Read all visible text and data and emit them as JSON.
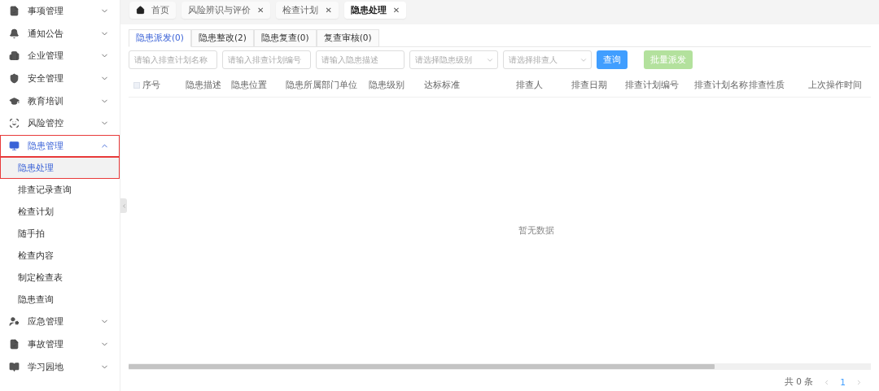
{
  "sidebar": {
    "items": [
      {
        "label": "事项管理",
        "expanded": false,
        "selected": false
      },
      {
        "label": "通知公告",
        "expanded": false,
        "selected": false
      },
      {
        "label": "企业管理",
        "expanded": false,
        "selected": false
      },
      {
        "label": "安全管理",
        "expanded": false,
        "selected": false
      },
      {
        "label": "教育培训",
        "expanded": false,
        "selected": false
      },
      {
        "label": "风险管控",
        "expanded": false,
        "selected": false
      },
      {
        "label": "隐患管理",
        "expanded": true,
        "selected": true,
        "children": [
          {
            "label": "隐患处理",
            "selected": true
          },
          {
            "label": "排查记录查询",
            "selected": false
          },
          {
            "label": "检查计划",
            "selected": false
          },
          {
            "label": "随手拍",
            "selected": false
          },
          {
            "label": "检查内容",
            "selected": false
          },
          {
            "label": "制定检查表",
            "selected": false
          },
          {
            "label": "隐患查询",
            "selected": false
          }
        ]
      },
      {
        "label": "应急管理",
        "expanded": false,
        "selected": false
      },
      {
        "label": "事故管理",
        "expanded": false,
        "selected": false
      },
      {
        "label": "学习园地",
        "expanded": false,
        "selected": false
      }
    ]
  },
  "page_tabs": [
    {
      "label": "首页",
      "kind": "home",
      "selected": false
    },
    {
      "label": "风险辨识与评价",
      "kind": "closable",
      "selected": false
    },
    {
      "label": "检查计划",
      "kind": "closable",
      "selected": false
    },
    {
      "label": "隐患处理",
      "kind": "closable",
      "selected": true
    }
  ],
  "close_glyph": "✕",
  "sub_tabs": [
    {
      "label": "隐患派发(0)",
      "selected": true
    },
    {
      "label": "隐患整改(2)",
      "selected": false
    },
    {
      "label": "隐患复查(0)",
      "selected": false
    },
    {
      "label": "复查审核(0)",
      "selected": false
    }
  ],
  "filters": [
    {
      "kind": "input",
      "placeholder": "请输入排查计划名称"
    },
    {
      "kind": "input",
      "placeholder": "请输入排查计划编号"
    },
    {
      "kind": "input",
      "placeholder": "请输入隐患描述"
    },
    {
      "kind": "select",
      "placeholder": "请选择隐患级别"
    },
    {
      "kind": "select",
      "placeholder": "请选择排查人"
    }
  ],
  "buttons": [
    {
      "label": "查询",
      "kind": "primary",
      "disabled": false
    },
    {
      "label": "批量派发",
      "kind": "success",
      "disabled": true
    }
  ],
  "table": {
    "select_all_checked": false,
    "columns": [
      "序号",
      "隐患描述",
      "隐患位置",
      "隐患所属部门单位",
      "隐患级别",
      "达标标准",
      "排查人",
      "排查日期",
      "排查计划编号",
      "排查计划名称",
      "排查性质",
      "上次操作时间"
    ],
    "empty_text": "暂无数据"
  },
  "pagination": {
    "total": "共 0 条",
    "pages": [
      {
        "label": "1",
        "selected": true
      }
    ]
  }
}
